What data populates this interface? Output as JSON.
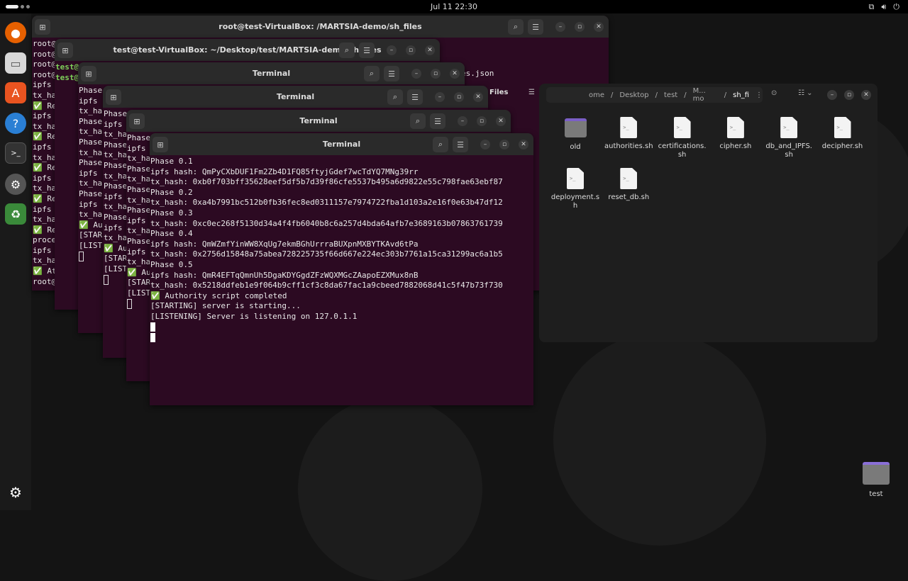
{
  "topbar": {
    "clock": "Jul 11  22:30",
    "tray": [
      "network-icon",
      "volume-icon",
      "power-icon"
    ]
  },
  "dock": [
    "firefox-icon",
    "files-icon",
    "app-center-icon",
    "help-icon",
    "terminal-icon",
    "settings-icon",
    "trash-icon",
    "show-apps-icon"
  ],
  "windows": [
    {
      "title": "root@test-VirtualBox: /MARTSIA-demo/sh_files",
      "extra": "es.json",
      "lines": [
        "root@",
        "root@",
        "root@",
        "root@",
        "ipfs",
        "tx_ha",
        "✅ Re",
        "ipfs",
        "tx_ha",
        "✅ Re",
        "ipfs",
        "tx_ha",
        "✅ Re",
        "ipfs",
        "tx_ha",
        "✅ Re",
        "ipfs",
        "tx_ha",
        "✅ Re",
        "proce",
        "ipfs",
        "tx_ha",
        "✅ At",
        "root@"
      ]
    },
    {
      "title": "test@test-VirtualBox: ~/Desktop/test/MARTSIA-demo/sh_files",
      "lines": [
        "test@",
        "test@"
      ]
    },
    {
      "title": "Terminal",
      "lines": [
        "Phase",
        "ipfs",
        "tx_ha",
        "Phase",
        "tx_ha",
        "Phase",
        "tx_ha",
        "Phase",
        "ipfs",
        "tx_ha",
        "Phase",
        "ipfs",
        "tx_ha",
        "✅ Au",
        "[STAR",
        "[LIST"
      ]
    },
    {
      "title": "Terminal",
      "lines": [
        "Phase",
        "ipfs",
        "tx_ha",
        "Phase",
        "tx_ha",
        "Phase",
        "tx_ha",
        "Phase",
        "ipfs",
        "tx_ha",
        "Phase",
        "ipfs",
        "tx_ha",
        "✅ Au",
        "[STAR",
        "[LIST"
      ]
    },
    {
      "title": "Terminal",
      "lines": [
        "Phase",
        "ipfs",
        "tx_ha",
        "Phase",
        "tx_ha",
        "Phase",
        "tx_ha",
        "Phase",
        "ipfs",
        "tx_ha",
        "Phase",
        "ipfs",
        "tx_ha",
        "✅ Au",
        "[STAR",
        "[LIST"
      ]
    },
    {
      "title": "Terminal",
      "lines": [
        "Phase 0.1",
        "ipfs hash: QmPyCXbDUF1Fm2Zb4D1FQ85ftyjGdef7wcTdYQ7MNg39rr",
        "tx_hash: 0xb0f703bff35628eef5df5b7d39f86cfe5537b495a6d9822e55c798fae63ebf87",
        "Phase 0.2",
        "tx_hash: 0xa4b7991bc512b0fb36fec8ed0311157e7974722fba1d103a2e16f0e63b47df12",
        "Phase 0.3",
        "tx_hash: 0xc0ec268f5130d34a4f4fb6040b8c6a257d4bda64afb7e3689163b07863761739",
        "Phase 0.4",
        "ipfs hash: QmWZmfYinWW8XqUg7ekmBGhUrrraBUXpnMXBYTKAvd6tPa",
        "tx_hash: 0x2756d15848a75abea728225735f66d667e224ec303b7761a15ca31299ac6a1b5",
        "Phase 0.5",
        "ipfs hash: QmR4EFTqQmnUh5DgaKDYGgdZFzWQXMGcZAapoEZXMux8nB",
        "tx_hash: 0x5218ddfeb1e9f064b9cff1cf3c8da67fac1a9cbeed7882068d41c5f47b73f730",
        "✅ Authority script completed",
        "[STARTING] server is starting...",
        "[LISTENING] Server is listening on 127.0.1.1"
      ]
    }
  ],
  "file_manager": {
    "partial_title": "Files",
    "breadcrumb": [
      "ome",
      "Desktop",
      "test",
      "M... mo",
      "sh_fi"
    ],
    "items": [
      {
        "name": "old",
        "type": "folder"
      },
      {
        "name": "authorities.sh",
        "type": "script"
      },
      {
        "name": "certifications.sh",
        "type": "script"
      },
      {
        "name": "cipher.sh",
        "type": "script"
      },
      {
        "name": "db_and_IPFS.sh",
        "type": "script"
      },
      {
        "name": "decipher.sh",
        "type": "script"
      },
      {
        "name": "deployment.sh",
        "type": "script"
      },
      {
        "name": "reset_db.sh",
        "type": "script"
      }
    ]
  },
  "desktop": {
    "folder_label": "test"
  }
}
